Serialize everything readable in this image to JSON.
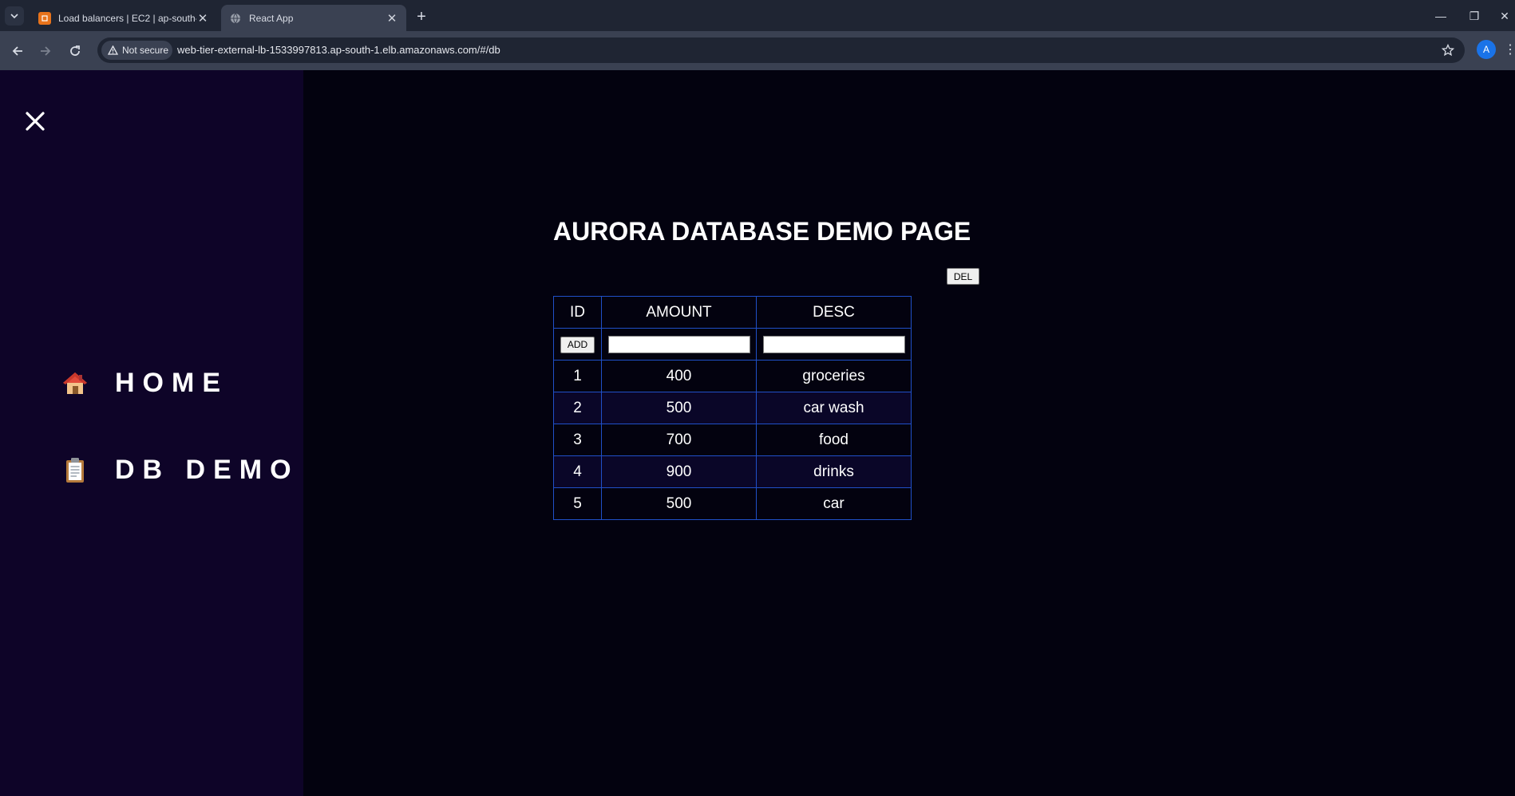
{
  "browser": {
    "tabs": [
      {
        "title": "Load balancers | EC2 | ap-south-1",
        "favicon": "aws-ec2-icon",
        "active": false
      },
      {
        "title": "React App",
        "favicon": "globe-icon",
        "active": true
      }
    ],
    "security_label": "Not secure",
    "url": "web-tier-external-lb-1533997813.ap-south-1.elb.amazonaws.com/#/db",
    "profile_initial": "A"
  },
  "sidebar": {
    "items": [
      {
        "label": "HOME",
        "icon": "house-icon"
      },
      {
        "label": "DB DEMO",
        "icon": "clipboard-icon"
      }
    ]
  },
  "main": {
    "title": "AURORA DATABASE DEMO PAGE",
    "del_label": "DEL",
    "add_label": "ADD",
    "table": {
      "headers": [
        "ID",
        "AMOUNT",
        "DESC"
      ],
      "amount_input": "",
      "desc_input": "",
      "rows": [
        {
          "id": "1",
          "amount": "400",
          "desc": "groceries"
        },
        {
          "id": "2",
          "amount": "500",
          "desc": "car wash"
        },
        {
          "id": "3",
          "amount": "700",
          "desc": "food"
        },
        {
          "id": "4",
          "amount": "900",
          "desc": "drinks"
        },
        {
          "id": "5",
          "amount": "500",
          "desc": "car"
        }
      ]
    }
  },
  "colors": {
    "page_bg": "#03020f",
    "sidebar_bg": "#0e0428",
    "table_border": "#2050c8"
  }
}
